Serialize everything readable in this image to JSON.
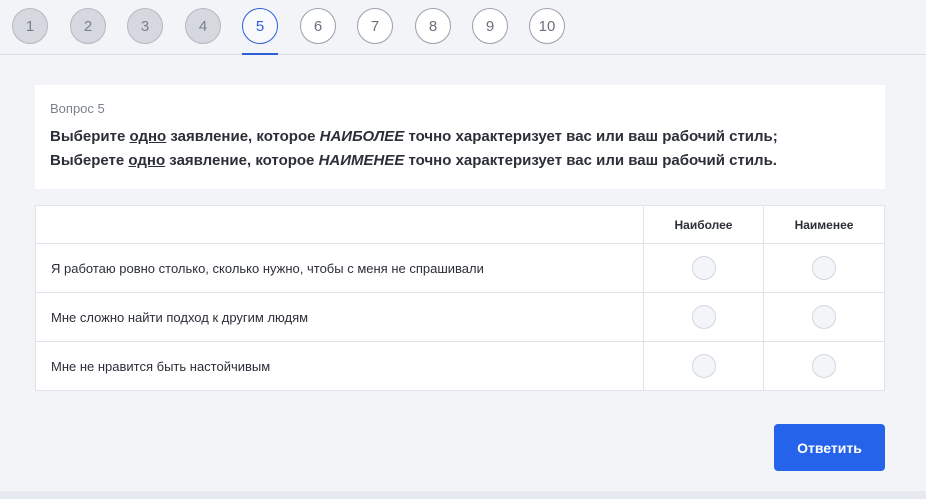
{
  "steps": [
    {
      "label": "1",
      "state": "done"
    },
    {
      "label": "2",
      "state": "done"
    },
    {
      "label": "3",
      "state": "done"
    },
    {
      "label": "4",
      "state": "done"
    },
    {
      "label": "5",
      "state": "current"
    },
    {
      "label": "6",
      "state": "pending"
    },
    {
      "label": "7",
      "state": "pending"
    },
    {
      "label": "8",
      "state": "pending"
    },
    {
      "label": "9",
      "state": "pending"
    },
    {
      "label": "10",
      "state": "pending"
    }
  ],
  "question": {
    "number_label": "Вопрос 5",
    "line1": {
      "prefix": "Выберите ",
      "underlined": "одно",
      "middle": " заявление, которое ",
      "italic": "НАИБОЛЕЕ",
      "suffix": " точно характеризует вас или ваш рабочий стиль;"
    },
    "line2": {
      "prefix": "Выберете ",
      "underlined": "одно",
      "middle": " заявление, которое ",
      "italic": "НАИМЕНЕЕ",
      "suffix": " точно характеризует вас или ваш рабочий стиль."
    }
  },
  "table": {
    "columns": [
      "Наиболее",
      "Наименее"
    ],
    "rows": [
      "Я работаю ровно столько, сколько нужно, чтобы с меня не спрашивали",
      "Мне сложно найти подход к другим людям",
      "Мне не нравится быть настойчивым"
    ]
  },
  "submit_label": "Ответить",
  "colors": {
    "accent": "#2563eb",
    "current_step": "#2f5fd8",
    "background": "#f2f4f8"
  }
}
